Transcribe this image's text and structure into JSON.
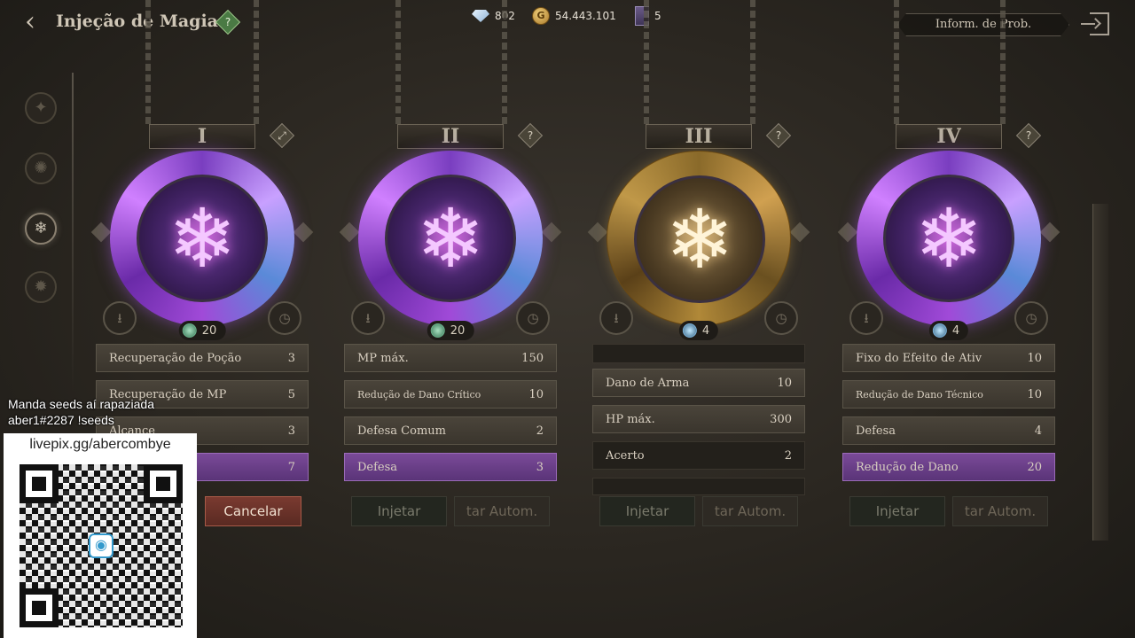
{
  "header": {
    "back_icon": "arrow-left",
    "title": "Injeção de Magia",
    "help": "?"
  },
  "currencies": [
    {
      "icon": "diamond-icon",
      "value": "802"
    },
    {
      "icon": "gold-coin-icon",
      "value": "54.443.101",
      "symbol": "G"
    },
    {
      "icon": "card-icon",
      "value": "5"
    }
  ],
  "prob_button": "Inform. de Prob.",
  "panels": [
    {
      "numeral": "I",
      "style": "purple",
      "count": "20",
      "stats": [
        {
          "name": "Recuperação de Poção",
          "value": "3"
        },
        {
          "name": "Recuperação de MP",
          "value": "5"
        },
        {
          "name": "Alcance",
          "value": "3"
        },
        {
          "name": "",
          "value": "7",
          "highlight": true
        }
      ],
      "button1": "",
      "button2": "Cancelar"
    },
    {
      "numeral": "II",
      "style": "purple",
      "count": "20",
      "stats": [
        {
          "name": "MP máx.",
          "value": "150"
        },
        {
          "name": "Redução de Dano Crítico",
          "value": "10",
          "small": true
        },
        {
          "name": "Defesa Comum",
          "value": "2"
        },
        {
          "name": "Defesa",
          "value": "3",
          "highlight": true
        }
      ],
      "button1": "Injetar",
      "button2": "tar Autom."
    },
    {
      "numeral": "III",
      "style": "gold",
      "count": "4",
      "stats": [
        {
          "name": "Dano de Arma",
          "value": "10"
        },
        {
          "name": "HP máx.",
          "value": "300"
        },
        {
          "name": "Acerto",
          "value": "2"
        }
      ],
      "button1": "Injetar",
      "button2": "tar Autom."
    },
    {
      "numeral": "IV",
      "style": "purple",
      "count": "4",
      "stats": [
        {
          "name": "Fixo do Efeito de Ativ",
          "value": "10"
        },
        {
          "name": "Redução de Dano Técnico",
          "value": "10",
          "small": true
        },
        {
          "name": "Defesa",
          "value": "4"
        },
        {
          "name": "Redução de Dano",
          "value": "20",
          "highlight": true
        }
      ],
      "button1": "Injetar",
      "button2": "tar Autom."
    }
  ],
  "overlay": {
    "line1": "Manda seeds aí rapaziada",
    "line2": "aber1#2287  !seeds",
    "url": "livepix.gg/abercombye"
  }
}
